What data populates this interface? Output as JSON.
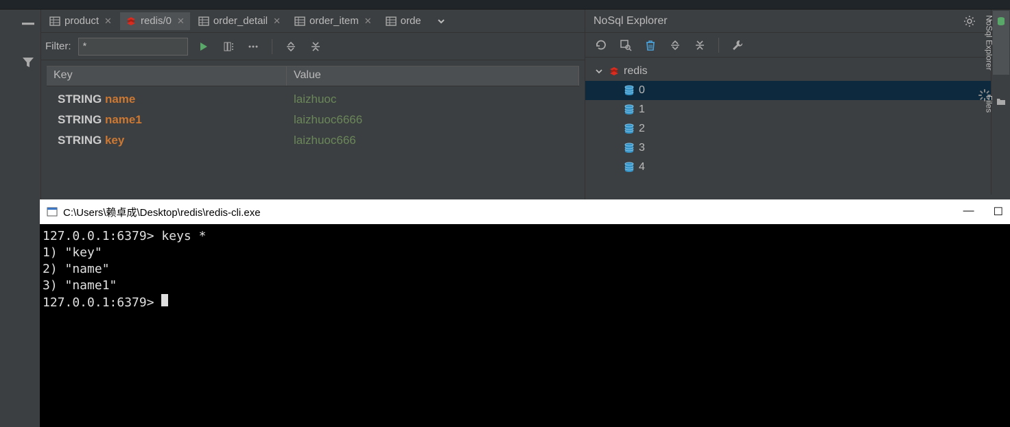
{
  "tabs": [
    {
      "label": "product",
      "type": "table"
    },
    {
      "label": "redis/0",
      "type": "redis",
      "active": true
    },
    {
      "label": "order_detail",
      "type": "table"
    },
    {
      "label": "order_item",
      "type": "table"
    },
    {
      "label": "orde",
      "type": "table",
      "truncated": true
    }
  ],
  "filter": {
    "label": "Filter:",
    "value": "*"
  },
  "table": {
    "headers": {
      "key": "Key",
      "value": "Value"
    },
    "rows": [
      {
        "type": "STRING",
        "key": "name",
        "value": "laizhuoc"
      },
      {
        "type": "STRING",
        "key": "name1",
        "value": "laizhuoc6666"
      },
      {
        "type": "STRING",
        "key": "key",
        "value": "laizhuoc666"
      }
    ]
  },
  "explorer": {
    "title": "NoSql Explorer",
    "root": "redis",
    "selected": "0",
    "databases": [
      "0",
      "1",
      "2",
      "3",
      "4"
    ]
  },
  "rightEdge": {
    "nosql": "NoSql Explorer",
    "files": "Files"
  },
  "terminal": {
    "title": "C:\\Users\\赖卓成\\Desktop\\redis\\redis-cli.exe",
    "lines": [
      "127.0.0.1:6379> keys *",
      "1) \"key\"",
      "2) \"name\"",
      "3) \"name1\"",
      "127.0.0.1:6379> "
    ]
  }
}
